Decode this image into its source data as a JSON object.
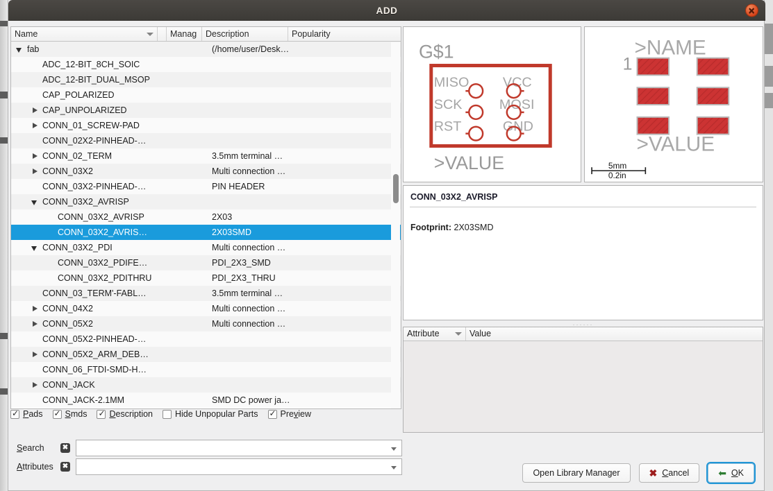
{
  "window": {
    "title": "ADD",
    "close_icon": "close-icon"
  },
  "tree": {
    "columns": [
      "Name",
      "",
      "Manag",
      "Description",
      "Popularity"
    ],
    "rows": [
      {
        "name": "fab",
        "indent": 0,
        "twisty": "open",
        "desc": "(/home/user/Desk…",
        "selected": false
      },
      {
        "name": "ADC_12-BIT_8CH_SOIC",
        "indent": 1,
        "twisty": "none",
        "desc": "",
        "selected": false
      },
      {
        "name": "ADC_12-BIT_DUAL_MSOP",
        "indent": 1,
        "twisty": "none",
        "desc": "",
        "selected": false
      },
      {
        "name": "CAP_POLARIZED",
        "indent": 1,
        "twisty": "none",
        "desc": "",
        "selected": false
      },
      {
        "name": "CAP_UNPOLARIZED",
        "indent": 1,
        "twisty": "closed",
        "desc": "",
        "selected": false
      },
      {
        "name": "CONN_01_SCREW-PAD",
        "indent": 1,
        "twisty": "closed",
        "desc": "",
        "selected": false
      },
      {
        "name": "CONN_02X2-PINHEAD-…",
        "indent": 1,
        "twisty": "none",
        "desc": "",
        "selected": false
      },
      {
        "name": "CONN_02_TERM",
        "indent": 1,
        "twisty": "closed",
        "desc": "3.5mm terminal …",
        "selected": false
      },
      {
        "name": "CONN_03X2",
        "indent": 1,
        "twisty": "closed",
        "desc": "Multi connection …",
        "selected": false
      },
      {
        "name": "CONN_03X2-PINHEAD-…",
        "indent": 1,
        "twisty": "none",
        "desc": "PIN HEADER",
        "selected": false
      },
      {
        "name": "CONN_03X2_AVRISP",
        "indent": 1,
        "twisty": "open",
        "desc": "",
        "selected": false
      },
      {
        "name": "CONN_03X2_AVRISP",
        "indent": 2,
        "twisty": "none",
        "desc": "2X03",
        "selected": false
      },
      {
        "name": "CONN_03X2_AVRIS…",
        "indent": 2,
        "twisty": "none",
        "desc": "2X03SMD",
        "selected": true
      },
      {
        "name": "CONN_03X2_PDI",
        "indent": 1,
        "twisty": "open",
        "desc": "Multi connection …",
        "selected": false
      },
      {
        "name": "CONN_03X2_PDIFE…",
        "indent": 2,
        "twisty": "none",
        "desc": "PDI_2X3_SMD",
        "selected": false
      },
      {
        "name": "CONN_03X2_PDITHRU",
        "indent": 2,
        "twisty": "none",
        "desc": "PDI_2X3_THRU",
        "selected": false
      },
      {
        "name": "CONN_03_TERM'-FABL…",
        "indent": 1,
        "twisty": "none",
        "desc": "3.5mm terminal …",
        "selected": false
      },
      {
        "name": "CONN_04X2",
        "indent": 1,
        "twisty": "closed",
        "desc": "Multi connection …",
        "selected": false
      },
      {
        "name": "CONN_05X2",
        "indent": 1,
        "twisty": "closed",
        "desc": "Multi connection …",
        "selected": false
      },
      {
        "name": "CONN_05X2-PINHEAD-…",
        "indent": 1,
        "twisty": "none",
        "desc": "",
        "selected": false
      },
      {
        "name": "CONN_05X2_ARM_DEB…",
        "indent": 1,
        "twisty": "closed",
        "desc": "",
        "selected": false
      },
      {
        "name": "CONN_06_FTDI-SMD-H…",
        "indent": 1,
        "twisty": "none",
        "desc": "",
        "selected": false
      },
      {
        "name": "CONN_JACK",
        "indent": 1,
        "twisty": "closed",
        "desc": "",
        "selected": false
      },
      {
        "name": "CONN_JACK-2.1MM",
        "indent": 1,
        "twisty": "none",
        "desc": "SMD DC power ja…",
        "selected": false
      }
    ]
  },
  "filters": {
    "checkboxes": [
      {
        "label": "Pads",
        "accel": "P",
        "checked": true
      },
      {
        "label": "Smds",
        "accel": "S",
        "checked": true
      },
      {
        "label": "Description",
        "accel": "D",
        "checked": true
      },
      {
        "label": "Hide Unpopular Parts",
        "accel": "",
        "checked": false
      },
      {
        "label": "Preview",
        "accel": "v",
        "checked": true
      }
    ],
    "search": {
      "label": "Search",
      "accel": "S",
      "value": "",
      "placeholder": ""
    },
    "attributes": {
      "label": "Attributes",
      "accel": "A",
      "value": "",
      "placeholder": ""
    }
  },
  "preview": {
    "symbol": {
      "device_name": "G$1",
      "value_text": ">VALUE",
      "pin_labels_left": [
        "MISO",
        "SCK",
        "RST"
      ],
      "pin_labels_right": [
        "VCC",
        "MOSI",
        "GND"
      ],
      "outline_color": "#c0392b"
    },
    "package": {
      "name_text": ">NAME",
      "value_text": ">VALUE",
      "pin_one_label": "1",
      "scale_mm": "5mm",
      "scale_in": "0.2in",
      "pad_color": "#cc3333"
    }
  },
  "info": {
    "title": "CONN_03X2_AVRISP",
    "footprint_label": "Footprint:",
    "footprint_value": "2X03SMD"
  },
  "attributes_table": {
    "columns": [
      "Attribute",
      "Value"
    ],
    "rows": []
  },
  "buttons": {
    "library_manager": "Open Library Manager",
    "cancel": "Cancel",
    "cancel_accel": "C",
    "ok": "OK",
    "ok_accel": "O"
  }
}
